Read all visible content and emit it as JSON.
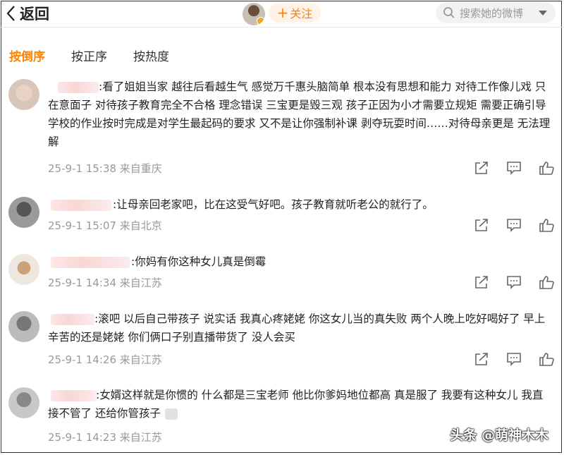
{
  "header": {
    "back_label": "返回",
    "follow_label": "关注",
    "search_placeholder": "搜索她的微博"
  },
  "sort_tabs": [
    "按倒序",
    "按正序",
    "按热度"
  ],
  "comments": [
    {
      "text": ":看了姐姐当家 越往后看越生气 感觉万千惠头脑简单 根本没有思想和能力 对待工作像儿戏 只在意面子 对待孩子教育完全不合格 理念错误 三宝更是毁三观 孩子正因为小才需要立规矩 需要正确引导 学校的作业按时完成是对学生最起码的要求 又不是让你强制补课 剥夺玩耍时间……对待母亲更是 无法理解",
      "time": "25-9-1 15:38",
      "location": "来自重庆"
    },
    {
      "text": ":让母亲回老家吧，比在这受气好吧。孩子教育就听老公的就行了。",
      "time": "25-9-1 15:07",
      "location": "来自北京"
    },
    {
      "text": ":你妈有你这种女儿真是倒霉",
      "time": "25-9-1 14:34",
      "location": "来自江苏"
    },
    {
      "text": ":滚吧 以后自己带孩子 说实话 我真心疼姥姥 你这女儿当的真失败 两个人晚上吃好喝好了 早上辛苦的还是姥姥 你们俩口子别直播带货了 没人会买",
      "time": "25-9-1 14:26",
      "location": "来自江苏"
    },
    {
      "text": ":女婿这样就是你惯的 什么都是三宝老师 他比你爹妈地位都高 真是服了 我要有这种女儿 我直接不管了 还给你管孩子",
      "time": "25-9-1 14:23",
      "location": "来自江苏"
    }
  ],
  "watermark": "头条 @萌神木木"
}
